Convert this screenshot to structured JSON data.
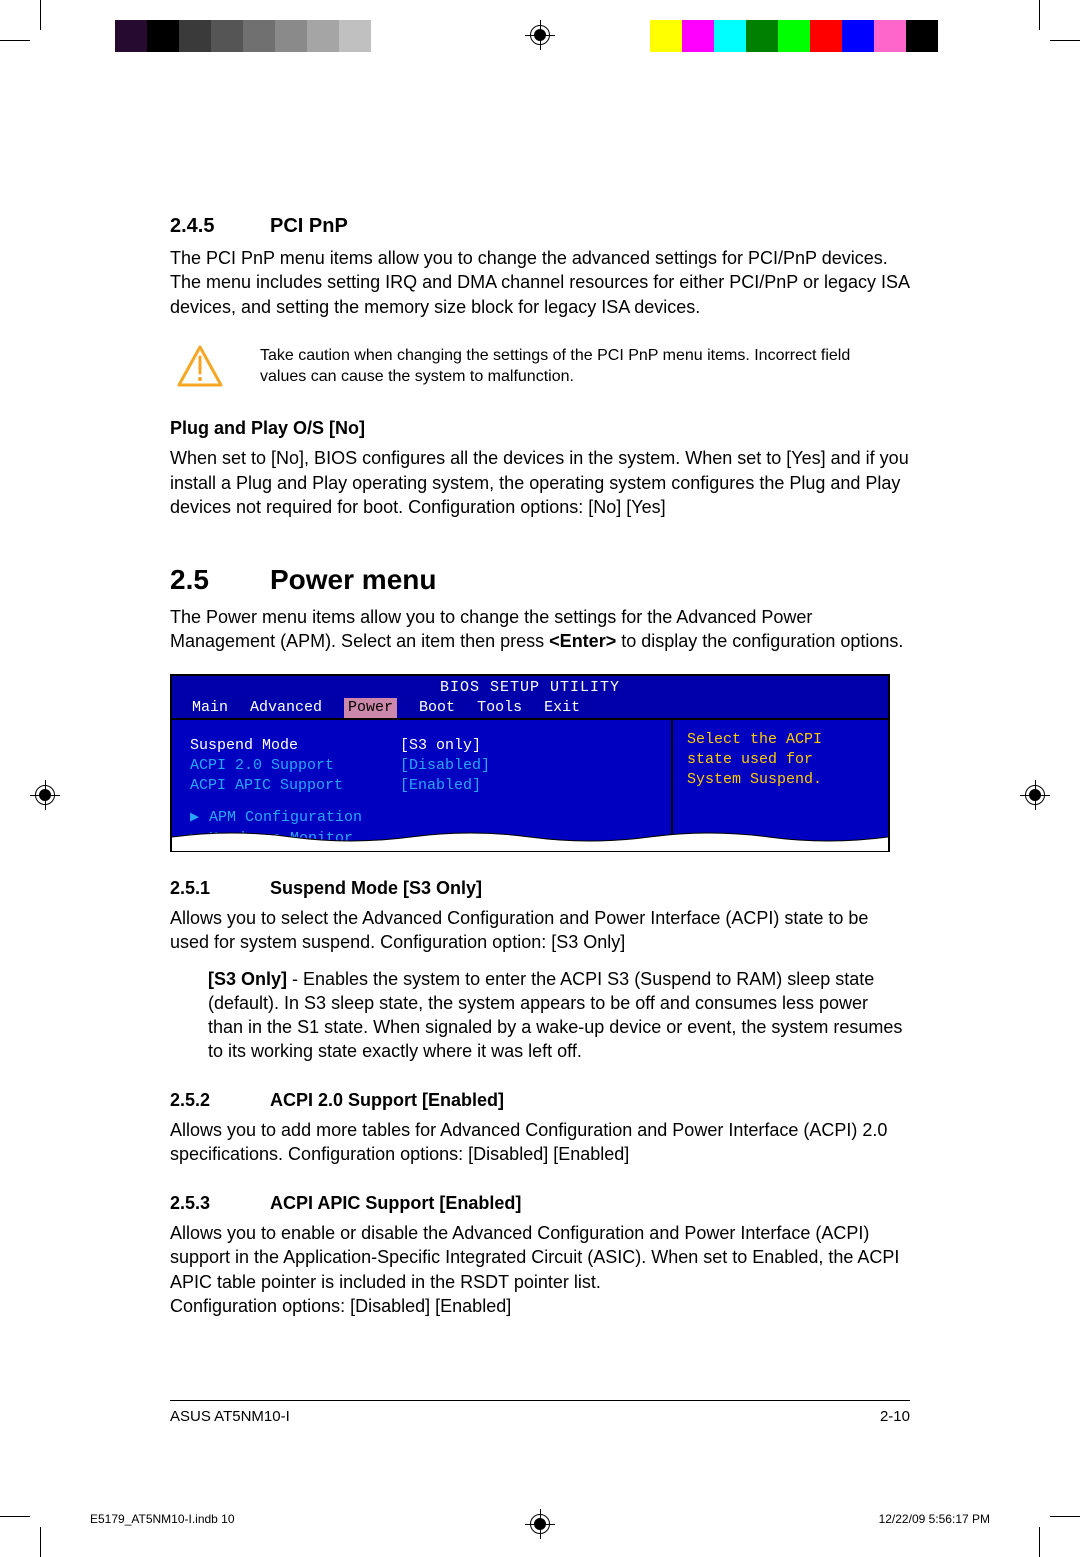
{
  "section_2_4_5": {
    "num": "2.4.5",
    "title": "PCI PnP",
    "para": "The PCI PnP menu items allow you to change the advanced settings for PCI/PnP devices. The menu includes setting IRQ and DMA channel resources for either PCI/PnP or legacy ISA devices, and setting the memory size block for legacy ISA devices."
  },
  "warning": "Take caution when changing the settings of the PCI PnP menu items. Incorrect field values can cause the system to malfunction.",
  "plug_and_play": {
    "head": "Plug and Play O/S [No]",
    "para": "When set to [No], BIOS configures all the devices in the system. When set to [Yes] and if you install a Plug and Play operating system, the operating system configures the Plug and Play devices not required for boot. Configuration options: [No] [Yes]"
  },
  "section_2_5": {
    "num": "2.5",
    "title": "Power menu",
    "para_a": "The Power menu items allow you to change the settings for the Advanced Power Management (APM). Select an item then press ",
    "enter": "<Enter>",
    "para_b": " to display the configuration options."
  },
  "bios": {
    "title": "BIOS SETUP UTILITY",
    "menu": [
      "Main",
      "Advanced",
      "Power",
      "Boot",
      "Tools",
      "Exit"
    ],
    "rows": [
      {
        "label": "Suspend Mode",
        "value": "[S3 only]"
      },
      {
        "label": "ACPI 2.0 Support",
        "value": "[Disabled]"
      },
      {
        "label": "ACPI APIC Support",
        "value": "[Enabled]"
      }
    ],
    "subs": [
      "APM Configuration",
      "Hardware Monitor"
    ],
    "help": "Select the ACPI state used for System Suspend."
  },
  "section_2_5_1": {
    "num": "2.5.1",
    "title": "Suspend Mode [S3 Only]",
    "para": "Allows you to select the Advanced Configuration and Power Interface (ACPI) state to be used for system suspend. Configuration option: [S3 Only]",
    "s3_bold": "[S3 Only]",
    "s3_rest": " - Enables the system to enter the ACPI S3 (Suspend to RAM) sleep state (default). In S3 sleep state, the system appears to be off and consumes less power than in the S1 state. When signaled by a wake-up device or event, the system resumes to its working state exactly where it was left off."
  },
  "section_2_5_2": {
    "num": "2.5.2",
    "title": "ACPI 2.0 Support [Enabled]",
    "para": "Allows you to add more tables for Advanced Configuration and Power Interface (ACPI) 2.0 specifications. Configuration options: [Disabled] [Enabled]"
  },
  "section_2_5_3": {
    "num": "2.5.3",
    "title": "ACPI APIC Support [Enabled]",
    "para": "Allows you to enable or disable the Advanced Configuration and Power Interface (ACPI) support in the Application-Specific Integrated Circuit (ASIC). When set to Enabled, the ACPI APIC table pointer is included in the RSDT pointer list.",
    "para2": "Configuration options: [Disabled] [Enabled]"
  },
  "footer": {
    "left": "ASUS AT5NM10-I",
    "right": "2-10"
  },
  "indb": {
    "left": "E5179_AT5NM10-I.indb   10",
    "right": "12/22/09   5:56:17 PM"
  },
  "colorbars": {
    "left": [
      "#260b2e",
      "#000000",
      "#3a3a3a",
      "#555555",
      "#707070",
      "#8a8a8a",
      "#a5a5a5",
      "#c0c0c0",
      "#ffffff"
    ],
    "right": [
      "#ffff00",
      "#ff00ff",
      "#00ffff",
      "#008000",
      "#00ff00",
      "#ff0000",
      "#0000ff",
      "#ff66cc",
      "#000000"
    ]
  }
}
